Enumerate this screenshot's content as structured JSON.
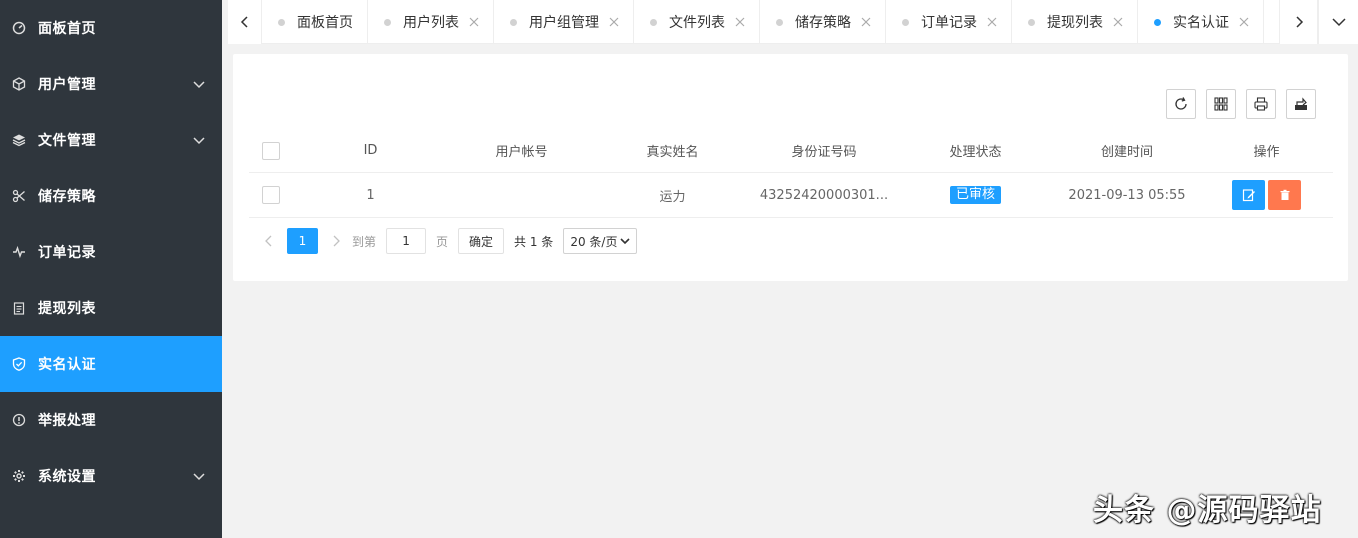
{
  "sidebar": {
    "items": [
      {
        "label": "面板首页",
        "icon": "dashboard-icon",
        "expandable": false,
        "active": false
      },
      {
        "label": "用户管理",
        "icon": "cube-icon",
        "expandable": true,
        "active": false
      },
      {
        "label": "文件管理",
        "icon": "layers-icon",
        "expandable": true,
        "active": false
      },
      {
        "label": "储存策略",
        "icon": "scissors-icon",
        "expandable": false,
        "active": false
      },
      {
        "label": "订单记录",
        "icon": "pulse-icon",
        "expandable": false,
        "active": false
      },
      {
        "label": "提现列表",
        "icon": "clipboard-icon",
        "expandable": false,
        "active": false
      },
      {
        "label": "实名认证",
        "icon": "shield-check-icon",
        "expandable": false,
        "active": true
      },
      {
        "label": "举报处理",
        "icon": "info-icon",
        "expandable": false,
        "active": false
      },
      {
        "label": "系统设置",
        "icon": "gear-icon",
        "expandable": true,
        "active": false
      }
    ]
  },
  "tabs": [
    {
      "label": "面板首页",
      "closable": false,
      "active": false
    },
    {
      "label": "用户列表",
      "closable": true,
      "active": false
    },
    {
      "label": "用户组管理",
      "closable": true,
      "active": false
    },
    {
      "label": "文件列表",
      "closable": true,
      "active": false
    },
    {
      "label": "储存策略",
      "closable": true,
      "active": false
    },
    {
      "label": "订单记录",
      "closable": true,
      "active": false
    },
    {
      "label": "提现列表",
      "closable": true,
      "active": false
    },
    {
      "label": "实名认证",
      "closable": true,
      "active": true
    }
  ],
  "toolbar": {
    "icons": [
      "refresh-icon",
      "columns-icon",
      "print-icon",
      "export-icon"
    ]
  },
  "table": {
    "headers": {
      "id": "ID",
      "account": "用户帐号",
      "real_name": "真实姓名",
      "id_number": "身份证号码",
      "status": "处理状态",
      "created": "创建时间",
      "actions": "操作"
    },
    "rows": [
      {
        "id": "1",
        "account": "",
        "real_name": "运力",
        "id_number": "43252420000301...",
        "status": "已审核",
        "created": "2021-09-13 05:55"
      }
    ]
  },
  "pager": {
    "current": "1",
    "goto_label": "到第",
    "goto_value": "1",
    "page_unit": "页",
    "confirm": "确定",
    "total": "共 1 条",
    "page_size": "20 条/页"
  },
  "colors": {
    "sidebar_bg": "#2f363d",
    "accent": "#1e9fff",
    "danger": "#ff5722"
  },
  "watermark": "头条 @源码驿站"
}
